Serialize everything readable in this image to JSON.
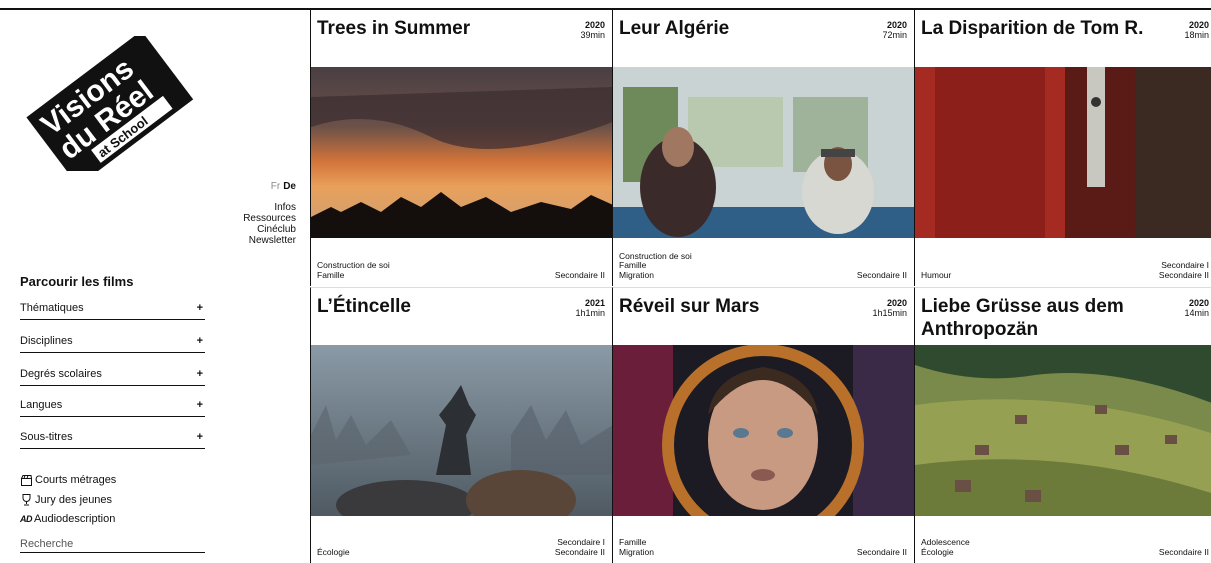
{
  "logo": {
    "line1": "Visions",
    "line2": "du Réel",
    "line3": "at School"
  },
  "language": {
    "fr": "Fr",
    "de": "De"
  },
  "topnav": [
    "Infos",
    "Ressources",
    "Cinéclub",
    "Newsletter"
  ],
  "browse": {
    "title": "Parcourir les films",
    "filters": [
      "Thématiques",
      "Disciplines",
      "Degrés scolaires",
      "Langues",
      "Sous-titres"
    ],
    "plus": "+"
  },
  "links": {
    "shorts": "Courts métrages",
    "jury": "Jury des jeunes",
    "audio_mark": "AD",
    "audio": "Audiodescription"
  },
  "search": {
    "placeholder": "Recherche"
  },
  "films": [
    {
      "title": "Trees in Summer",
      "year": "2020",
      "duration": "39min",
      "tags": [
        "Construction de soi",
        "Famille"
      ],
      "levels": [
        "Secondaire II"
      ]
    },
    {
      "title": "Leur Algérie",
      "year": "2020",
      "duration": "72min",
      "tags": [
        "Construction de soi",
        "Famille",
        "Migration"
      ],
      "levels": [
        "Secondaire II"
      ]
    },
    {
      "title": "La Disparition de Tom R.",
      "year": "2020",
      "duration": "18min",
      "tags": [
        "Humour"
      ],
      "levels": [
        "Secondaire I",
        "Secondaire II"
      ]
    },
    {
      "title": "L’Étincelle",
      "year": "2021",
      "duration": "1h1min",
      "tags": [
        "Écologie"
      ],
      "levels": [
        "Secondaire I",
        "Secondaire II"
      ]
    },
    {
      "title": "Réveil sur Mars",
      "year": "2020",
      "duration": "1h15min",
      "tags": [
        "Famille",
        "Migration"
      ],
      "levels": [
        "Secondaire II"
      ]
    },
    {
      "title": "Liebe Grüsse aus dem Anthropozän",
      "year": "2020",
      "duration": "14min",
      "tags": [
        "Adolescence",
        "Écologie"
      ],
      "levels": [
        "Secondaire II"
      ]
    }
  ],
  "icons": {
    "shorts": "film-clapper-icon",
    "jury": "trophy-icon",
    "expand": "plus-icon"
  }
}
